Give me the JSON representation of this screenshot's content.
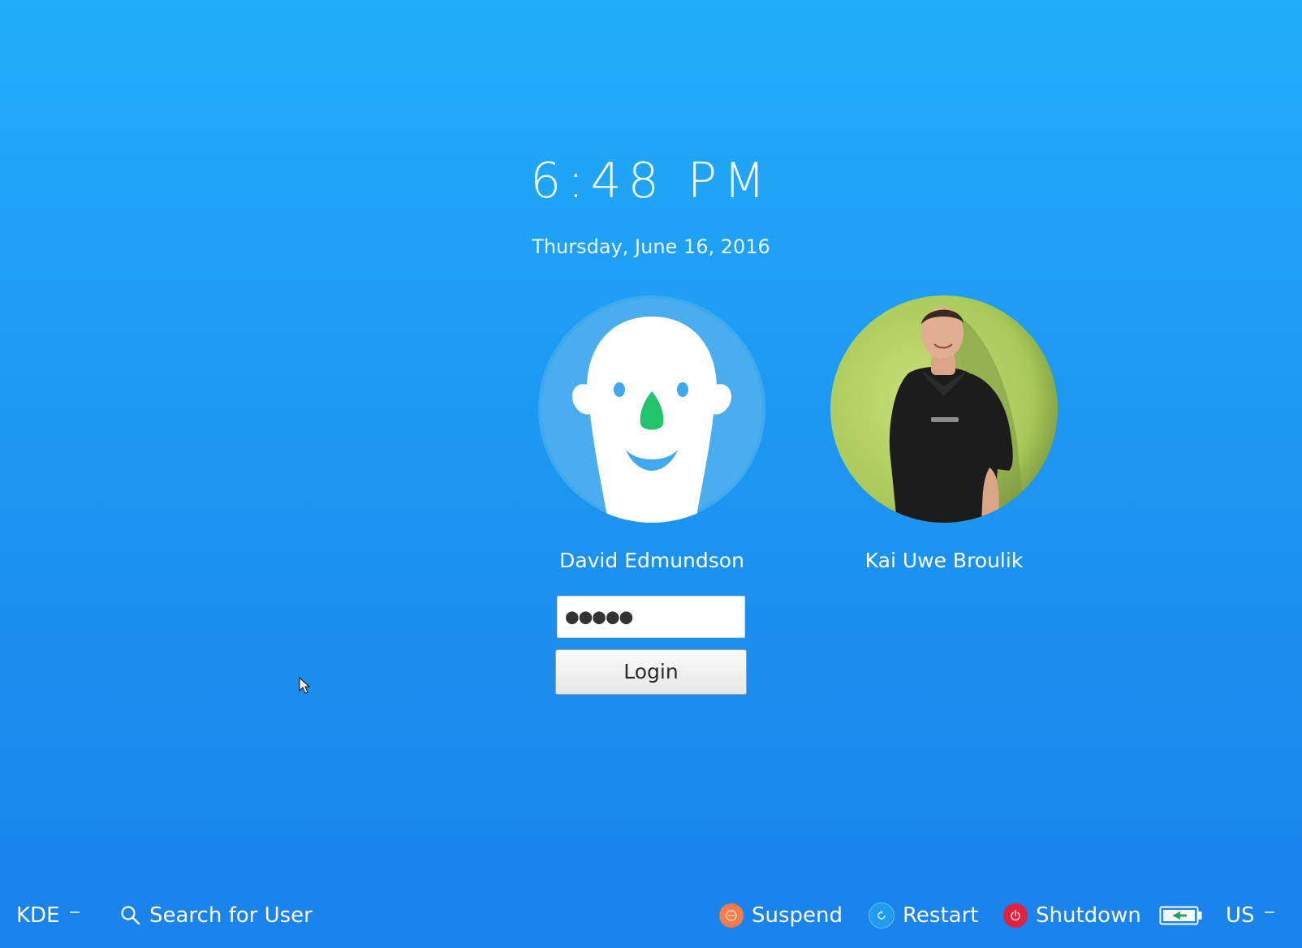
{
  "clock": {
    "time": "6:48 PM"
  },
  "date": {
    "text": "Thursday, June 16, 2016"
  },
  "users": [
    {
      "name": "David Edmundson",
      "avatar": "cartoon-face-avatar"
    },
    {
      "name": "Kai Uwe Broulik",
      "avatar": "photo-avatar"
    }
  ],
  "password": {
    "value": "●●●●●"
  },
  "login": {
    "label": "Login"
  },
  "bottom_bar": {
    "session": {
      "label": "KDE"
    },
    "search": {
      "label": "Search for User",
      "icon": "search-icon"
    },
    "suspend": {
      "label": "Suspend",
      "icon": "suspend-icon",
      "color": "#f47b4c"
    },
    "restart": {
      "label": "Restart",
      "icon": "restart-icon",
      "color": "#1f9bf0"
    },
    "shutdown": {
      "label": "Shutdown",
      "icon": "power-icon",
      "color": "#e2203f"
    },
    "battery": {
      "icon": "battery-charging-icon"
    },
    "keyboard_layout": {
      "label": "US"
    }
  },
  "colors": {
    "background_top": "#21adf9",
    "background_bottom": "#1a82ec"
  }
}
